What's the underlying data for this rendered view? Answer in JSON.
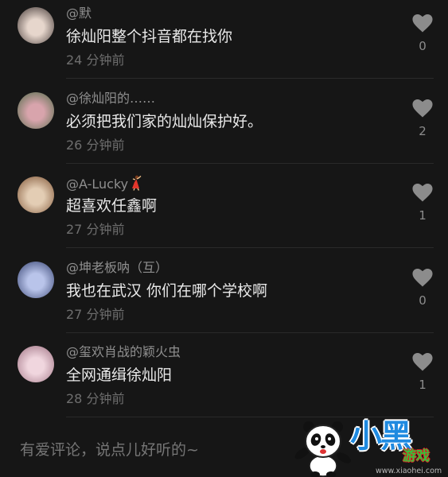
{
  "colors": {
    "background": "#161616",
    "username": "#8f8f8f",
    "comment_text": "#e9e9e9",
    "timestamp": "#6e6e6e",
    "heart": "#8c8c8c",
    "divider": "#2a2a2a",
    "placeholder": "#767676"
  },
  "comments": [
    {
      "username": "@默",
      "text": "徐灿阳整个抖音都在找你",
      "time": "24 分钟前",
      "likes": "0",
      "avatar_colors": [
        "#e6d6cc",
        "#3f3432"
      ]
    },
    {
      "username": "@徐灿阳的……",
      "text": "必须把我们家的灿灿保护好。",
      "time": "26 分钟前",
      "likes": "2",
      "avatar_colors": [
        "#d8a4ac",
        "#4f6b48"
      ]
    },
    {
      "username": "@A-Lucky",
      "username_icon": "dancer-emoji",
      "text": "超喜欢任鑫啊",
      "time": "27 分钟前",
      "likes": "1",
      "avatar_colors": [
        "#e3cdb4",
        "#7d5233"
      ]
    },
    {
      "username": "@坤老板呐（互）",
      "text": "我也在武汉 你们在哪个学校啊",
      "time": "27 分钟前",
      "likes": "0",
      "avatar_colors": [
        "#b9c4ea",
        "#33406e"
      ]
    },
    {
      "username": "@玺欢肖战的颖火虫",
      "text": "全网通缉徐灿阳",
      "time": "28 分钟前",
      "likes": "1",
      "avatar_colors": [
        "#f0d6de",
        "#9c6f80"
      ]
    }
  ],
  "icons": {
    "like": "heart-icon",
    "watermark": "panda-mascot"
  },
  "input": {
    "placeholder": "有爱评论，说点儿好听的~"
  },
  "watermark": {
    "logo_text": "小黑",
    "badge_text": "游戏",
    "url": "www.xiaohei.com"
  }
}
